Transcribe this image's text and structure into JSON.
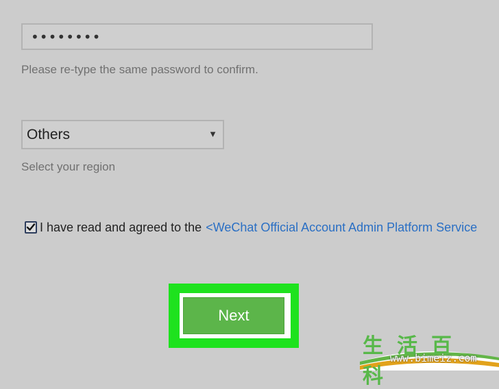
{
  "password": {
    "masked_value": "••••••••",
    "hint": "Please re-type the same password to confirm."
  },
  "region": {
    "selected": "Others",
    "arrow": "▼",
    "hint": "Select your region"
  },
  "agreement": {
    "checked": true,
    "text": "I have read and agreed to the",
    "link": "<WeChat Official Account Admin Platform Service"
  },
  "next_button": {
    "label": "Next"
  },
  "watermark": {
    "chars": "生活百科",
    "url": "www.bimeiz.com"
  },
  "colors": {
    "background": "#cccccc",
    "link": "#2a6fc4",
    "button": "#5cb54a",
    "highlight": "#1ee21e"
  }
}
